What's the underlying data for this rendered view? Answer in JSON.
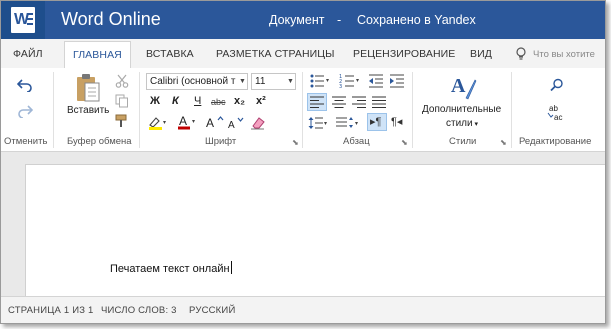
{
  "titlebar": {
    "app_name": "Word Online",
    "document_name": "Документ",
    "separator": "-",
    "save_status": "Сохранено в Yandex",
    "colors": {
      "bar": "#2b579a",
      "logo_bg": "#1e4e8c"
    }
  },
  "tabs": [
    {
      "label": "ФАЙЛ"
    },
    {
      "label": "ГЛАВНАЯ",
      "active": true
    },
    {
      "label": "ВСТАВКА"
    },
    {
      "label": "РАЗМЕТКА СТРАНИЦЫ"
    },
    {
      "label": "РЕЦЕНЗИРОВАНИЕ"
    },
    {
      "label": "ВИД"
    }
  ],
  "tell_me": {
    "placeholder": "Что вы хотите"
  },
  "ribbon": {
    "undo_group": {
      "label": "Отменить"
    },
    "clipboard": {
      "paste_label": "Вставить",
      "label": "Буфер обмена"
    },
    "font": {
      "font_name": "Calibri (основной т",
      "font_size": "11",
      "bold": "Ж",
      "italic": "К",
      "underline": "Ч",
      "strike": "abc",
      "subscript": "x₂",
      "superscript": "x²",
      "label": "Шрифт"
    },
    "paragraph": {
      "label": "Абзац"
    },
    "styles": {
      "more_line1": "Дополнительные",
      "more_line2": "стили",
      "label": "Стили"
    },
    "editing": {
      "replace_glyph": "ab→ac",
      "label": "Редактирование"
    }
  },
  "document": {
    "body_text": "Печатаем текст онлайн"
  },
  "statusbar": {
    "page": "СТРАНИЦА 1 ИЗ 1",
    "words": "ЧИСЛО СЛОВ: 3",
    "language": "РУССКИЙ"
  }
}
